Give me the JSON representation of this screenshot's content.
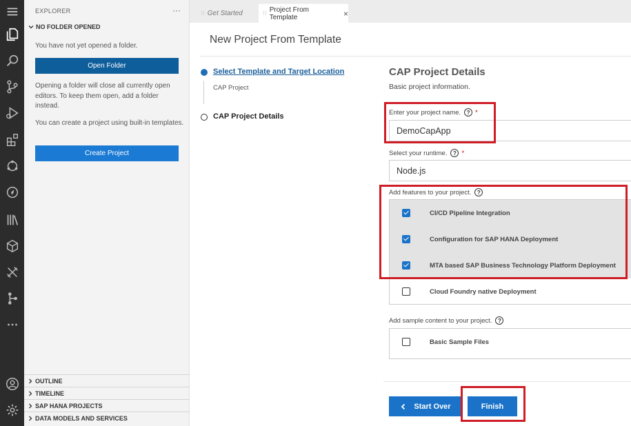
{
  "explorer": {
    "title": "EXPLORER",
    "more": "···",
    "section_title": "NO FOLDER OPENED",
    "info_1": "You have not yet opened a folder.",
    "open_folder_label": "Open Folder",
    "info_2": "Opening a folder will close all currently open editors. To keep them open, add a folder instead.",
    "info_3": "You can create a project using built-in templates.",
    "create_project_label": "Create Project"
  },
  "panels": [
    {
      "label": "OUTLINE"
    },
    {
      "label": "TIMELINE"
    },
    {
      "label": "SAP HANA PROJECTS"
    },
    {
      "label": "DATA MODELS AND SERVICES"
    }
  ],
  "tabs": [
    {
      "label": "Get Started",
      "active": false
    },
    {
      "label": "Project From Template",
      "active": true,
      "close": "×"
    }
  ],
  "wizard": {
    "title": "New Project From Template",
    "steps": [
      {
        "label": "Select Template and Target Location",
        "sublabel": "CAP Project",
        "status": "current"
      },
      {
        "label": "CAP Project Details",
        "status": "pending"
      }
    ]
  },
  "form": {
    "title": "CAP Project Details",
    "subtitle": "Basic project information.",
    "project_name": {
      "label": "Enter your project name.",
      "required": "*",
      "value": "DemoCapApp"
    },
    "runtime": {
      "label": "Select your runtime.",
      "required": "*",
      "value": "Node.js"
    },
    "features": {
      "label": "Add features to your project.",
      "items": [
        {
          "label": "CI/CD Pipeline Integration",
          "checked": true
        },
        {
          "label": "Configuration for SAP HANA Deployment",
          "checked": true
        },
        {
          "label": "MTA based SAP Business Technology Platform Deployment",
          "checked": true
        },
        {
          "label": "Cloud Foundry native Deployment",
          "checked": false
        }
      ]
    },
    "sample": {
      "label": "Add sample content to your project.",
      "items": [
        {
          "label": "Basic Sample Files",
          "checked": false
        }
      ]
    },
    "help_glyph": "?"
  },
  "buttons": {
    "start_over": "Start Over",
    "finish": "Finish"
  },
  "colors": {
    "accent": "#1a73c8",
    "highlight": "#d01c25",
    "activity_bar": "#2c2c2c"
  }
}
